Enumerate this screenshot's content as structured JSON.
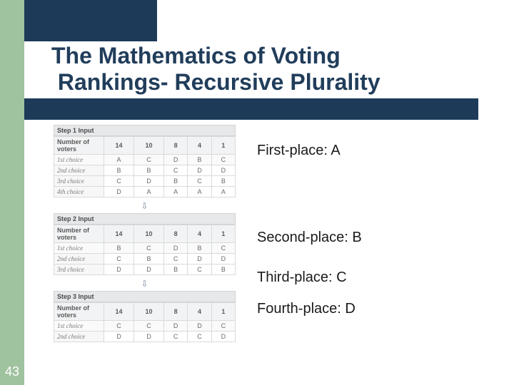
{
  "page_number": "43",
  "title_line1": "The Mathematics of Voting",
  "title_line2": "Rankings- Recursive Plurality",
  "results": {
    "first": "First-place: A",
    "second": "Second-place: B",
    "third": "Third-place: C",
    "fourth": "Fourth-place: D"
  },
  "labels": {
    "num_voters": "Number of voters",
    "c1": "1st choice",
    "c2": "2nd choice",
    "c3": "3rd choice",
    "c4": "4th choice"
  },
  "steps": [
    {
      "caption": "Step 1 Input",
      "counts": [
        "14",
        "10",
        "8",
        "4",
        "1"
      ],
      "rows": [
        [
          "A",
          "C",
          "D",
          "B",
          "C"
        ],
        [
          "B",
          "B",
          "C",
          "D",
          "D"
        ],
        [
          "C",
          "D",
          "B",
          "C",
          "B"
        ],
        [
          "D",
          "A",
          "A",
          "A",
          "A"
        ]
      ]
    },
    {
      "caption": "Step 2 Input",
      "counts": [
        "14",
        "10",
        "8",
        "4",
        "1"
      ],
      "rows": [
        [
          "B",
          "C",
          "D",
          "B",
          "C"
        ],
        [
          "C",
          "B",
          "C",
          "D",
          "D"
        ],
        [
          "D",
          "D",
          "B",
          "C",
          "B"
        ]
      ]
    },
    {
      "caption": "Step 3 Input",
      "counts": [
        "14",
        "10",
        "8",
        "4",
        "1"
      ],
      "rows": [
        [
          "C",
          "C",
          "D",
          "D",
          "C"
        ],
        [
          "D",
          "D",
          "C",
          "C",
          "D"
        ]
      ]
    }
  ]
}
